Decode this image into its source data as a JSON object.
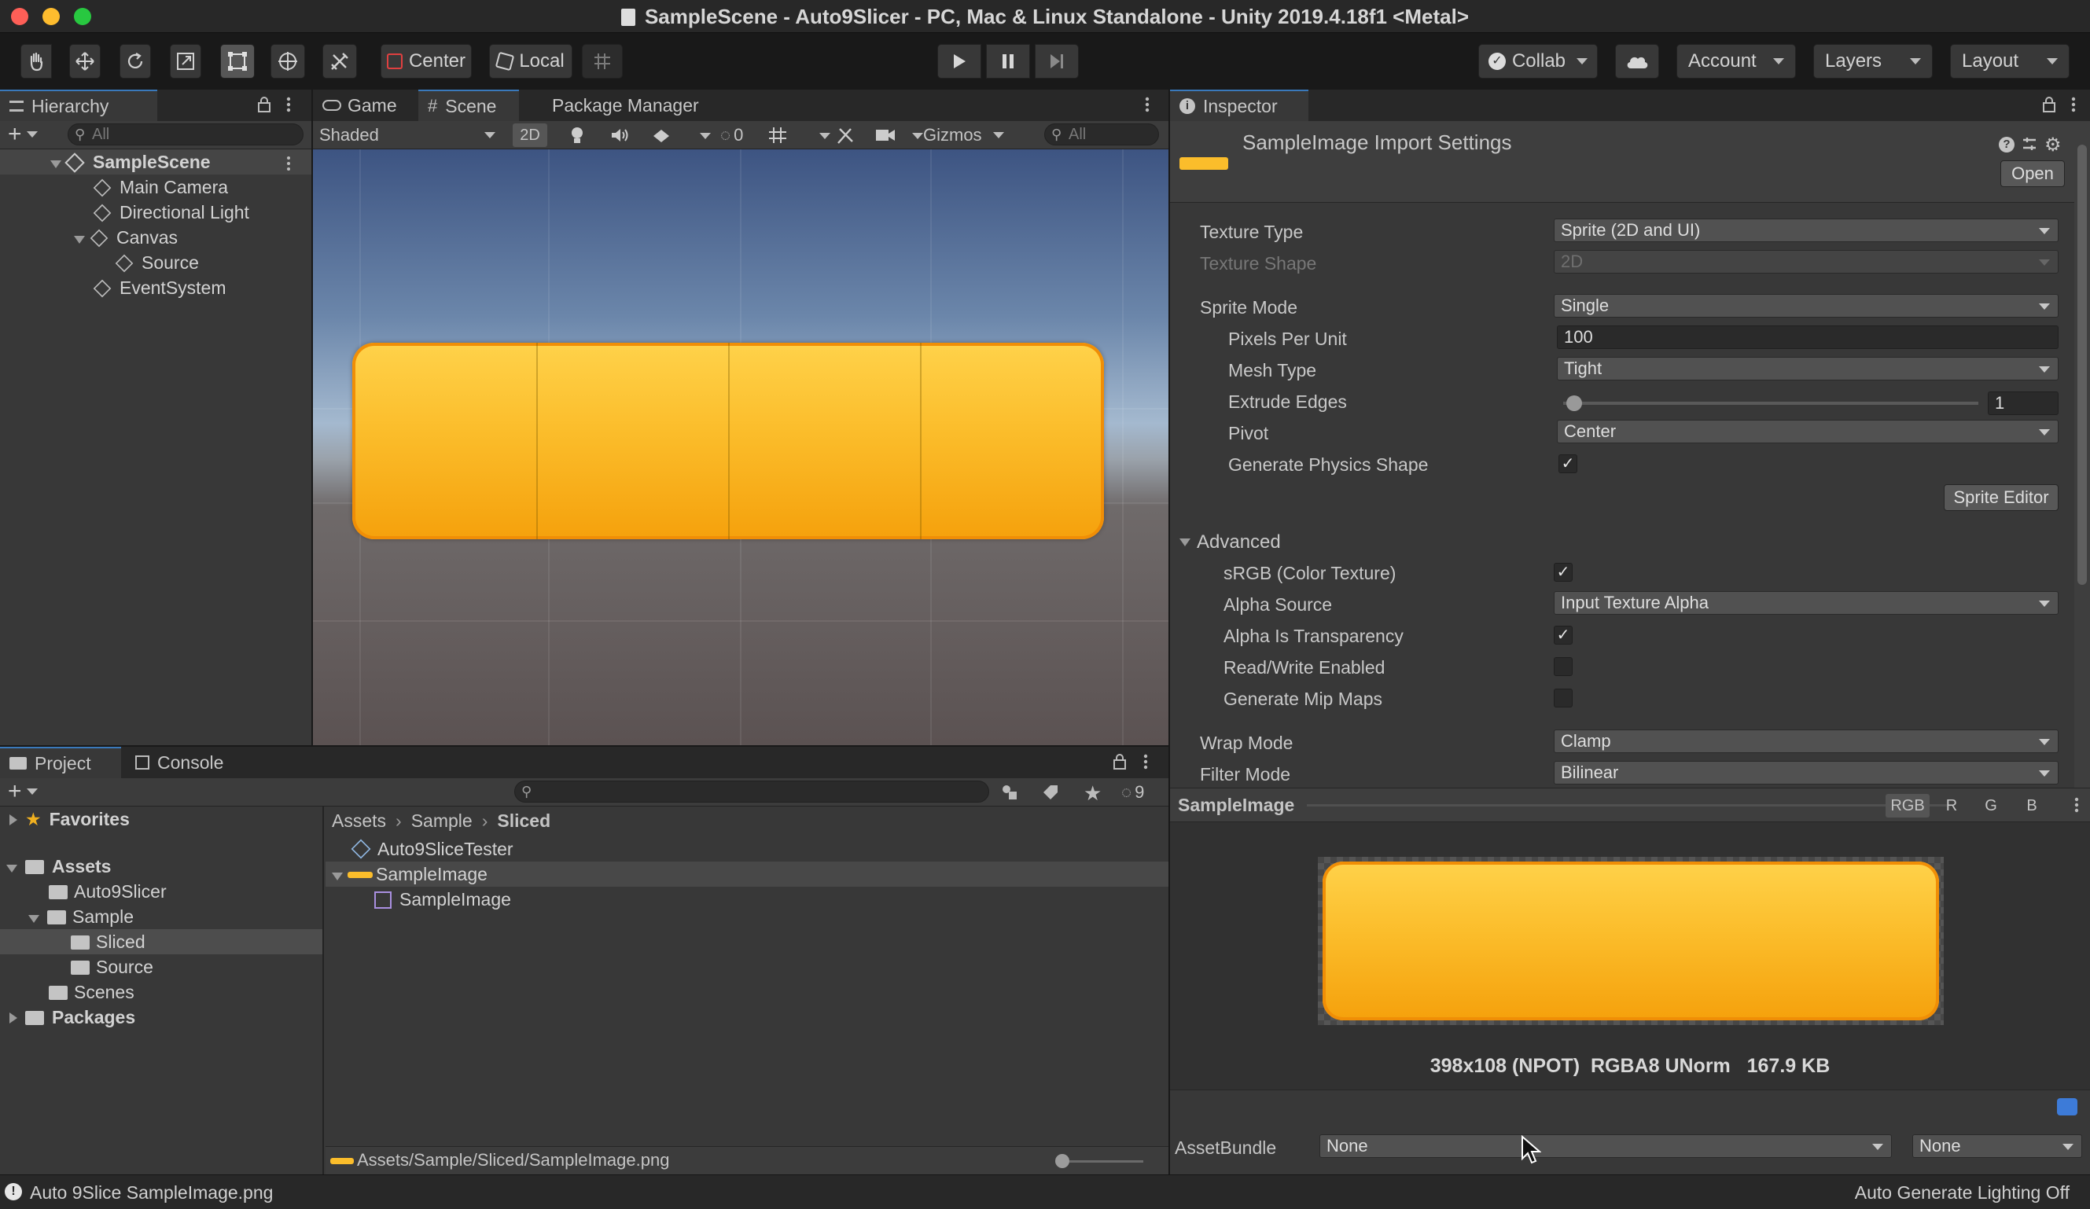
{
  "window": {
    "title": "SampleScene - Auto9Slicer - PC, Mac & Linux Standalone - Unity 2019.4.18f1 <Metal>"
  },
  "toolbar": {
    "pivot_mode": "Center",
    "pivot_rotation": "Local",
    "collab": "Collab",
    "account": "Account",
    "layers": "Layers",
    "layout": "Layout"
  },
  "hierarchy": {
    "tab": "Hierarchy",
    "search_placeholder": "All",
    "items": [
      {
        "label": "SampleScene"
      },
      {
        "label": "Main Camera"
      },
      {
        "label": "Directional Light"
      },
      {
        "label": "Canvas"
      },
      {
        "label": "Source"
      },
      {
        "label": "EventSystem"
      }
    ]
  },
  "scene": {
    "tabs": [
      "Game",
      "Scene",
      "Package Manager"
    ],
    "draw_mode": "Shaded",
    "mode_2d": "2D",
    "hidden_count": "0",
    "gizmos": "Gizmos",
    "search_placeholder": "All"
  },
  "project": {
    "tabs": [
      "Project",
      "Console"
    ],
    "hidden_count": "9",
    "favorites": "Favorites",
    "tree": [
      {
        "label": "Assets"
      },
      {
        "label": "Auto9Slicer"
      },
      {
        "label": "Sample"
      },
      {
        "label": "Sliced"
      },
      {
        "label": "Source"
      },
      {
        "label": "Scenes"
      },
      {
        "label": "Packages"
      }
    ],
    "breadcrumb": [
      "Assets",
      "Sample",
      "Sliced"
    ],
    "files": [
      {
        "label": "Auto9SliceTester"
      },
      {
        "label": "SampleImage"
      },
      {
        "label": "SampleImage"
      }
    ],
    "footer_path": "Assets/Sample/Sliced/SampleImage.png"
  },
  "inspector": {
    "tab": "Inspector",
    "header": "SampleImage Import Settings",
    "open_button": "Open",
    "props": {
      "texture_type": {
        "label": "Texture Type",
        "value": "Sprite (2D and UI)"
      },
      "texture_shape": {
        "label": "Texture Shape",
        "value": "2D"
      },
      "sprite_mode": {
        "label": "Sprite Mode",
        "value": "Single"
      },
      "pixels_per_unit": {
        "label": "Pixels Per Unit",
        "value": "100"
      },
      "mesh_type": {
        "label": "Mesh Type",
        "value": "Tight"
      },
      "extrude_edges": {
        "label": "Extrude Edges",
        "value": "1"
      },
      "pivot": {
        "label": "Pivot",
        "value": "Center"
      },
      "physics_shape": {
        "label": "Generate Physics Shape",
        "checked": true
      }
    },
    "sprite_editor_button": "Sprite Editor",
    "advanced": {
      "label": "Advanced",
      "srgb": {
        "label": "sRGB (Color Texture)",
        "checked": true
      },
      "alpha_source": {
        "label": "Alpha Source",
        "value": "Input Texture Alpha"
      },
      "alpha_transparency": {
        "label": "Alpha Is Transparency",
        "checked": true
      },
      "read_write": {
        "label": "Read/Write Enabled",
        "checked": false
      },
      "mip_maps": {
        "label": "Generate Mip Maps",
        "checked": false
      }
    },
    "wrap_mode": {
      "label": "Wrap Mode",
      "value": "Clamp"
    },
    "filter_mode": {
      "label": "Filter Mode",
      "value": "Bilinear"
    },
    "preview": {
      "title": "SampleImage",
      "channels": [
        "RGB",
        "R",
        "G",
        "B"
      ],
      "info": "398x108 (NPOT)  RGBA8 UNorm   167.9 KB"
    },
    "assetbundle": {
      "label": "AssetBundle",
      "value": "None",
      "variant": "None"
    }
  },
  "status": {
    "message": "Auto 9Slice SampleImage.png",
    "right": "Auto Generate Lighting Off"
  },
  "colors": {
    "accent": "#3a79bb",
    "button_yellow": "#fbbd2b",
    "button_orange": "#f5a10c"
  }
}
